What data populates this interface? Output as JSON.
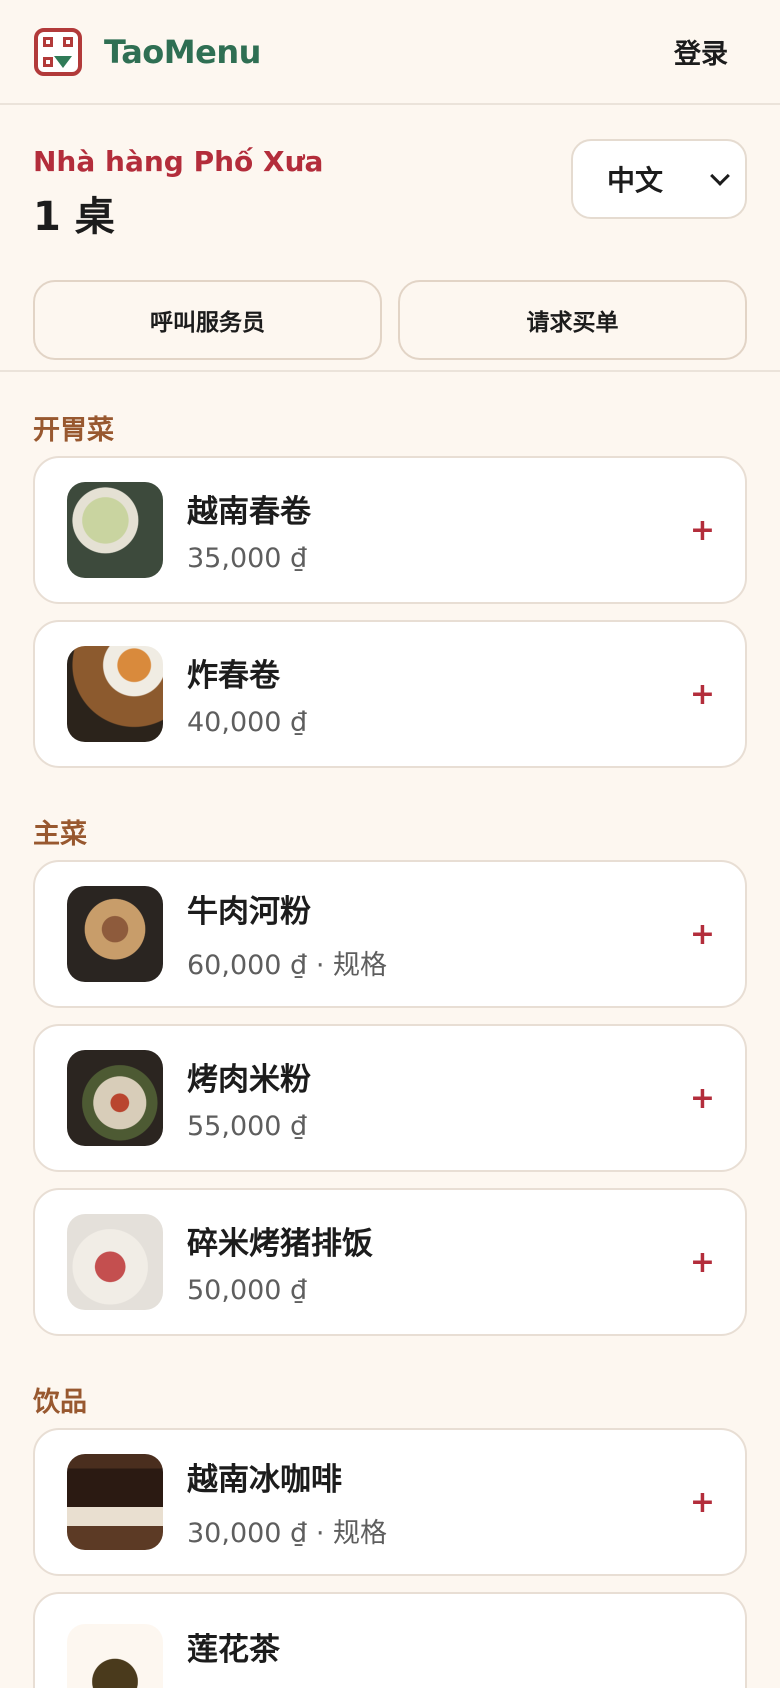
{
  "header": {
    "brand": "TaoMenu",
    "login_label": "登录"
  },
  "restaurant": {
    "name": "Nhà hàng Phố Xưa",
    "table": "1 桌",
    "language": "中文"
  },
  "actions": {
    "call_waiter": "呼叫服务员",
    "request_bill": "请求买单"
  },
  "sections": [
    {
      "title": "开胃菜",
      "items": [
        {
          "name": "越南春卷",
          "price": "35,000 ₫",
          "add": "+"
        },
        {
          "name": "炸春卷",
          "price": "40,000 ₫",
          "add": "+"
        }
      ]
    },
    {
      "title": "主菜",
      "items": [
        {
          "name": "牛肉河粉",
          "price": "60,000 ₫ · 规格",
          "add": "+"
        },
        {
          "name": "烤肉米粉",
          "price": "55,000 ₫",
          "add": "+"
        },
        {
          "name": "碎米烤猪排饭",
          "price": "50,000 ₫",
          "add": "+"
        }
      ]
    },
    {
      "title": "饮品",
      "items": [
        {
          "name": "越南冰咖啡",
          "price": "30,000 ₫ · 规格",
          "add": "+"
        },
        {
          "name": "莲花茶",
          "price": "",
          "add": ""
        }
      ]
    }
  ],
  "colors": {
    "accent": "#b32d3b",
    "brand": "#2f6f53",
    "section": "#98582f",
    "background": "#fdf7f0"
  }
}
